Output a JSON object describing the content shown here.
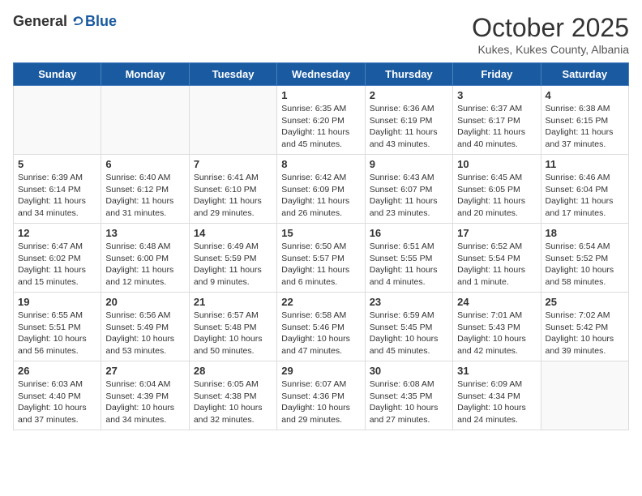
{
  "header": {
    "logo_general": "General",
    "logo_blue": "Blue",
    "month_title": "October 2025",
    "location": "Kukes, Kukes County, Albania"
  },
  "weekdays": [
    "Sunday",
    "Monday",
    "Tuesday",
    "Wednesday",
    "Thursday",
    "Friday",
    "Saturday"
  ],
  "weeks": [
    [
      {
        "day": "",
        "text": ""
      },
      {
        "day": "",
        "text": ""
      },
      {
        "day": "",
        "text": ""
      },
      {
        "day": "1",
        "text": "Sunrise: 6:35 AM\nSunset: 6:20 PM\nDaylight: 11 hours\nand 45 minutes."
      },
      {
        "day": "2",
        "text": "Sunrise: 6:36 AM\nSunset: 6:19 PM\nDaylight: 11 hours\nand 43 minutes."
      },
      {
        "day": "3",
        "text": "Sunrise: 6:37 AM\nSunset: 6:17 PM\nDaylight: 11 hours\nand 40 minutes."
      },
      {
        "day": "4",
        "text": "Sunrise: 6:38 AM\nSunset: 6:15 PM\nDaylight: 11 hours\nand 37 minutes."
      }
    ],
    [
      {
        "day": "5",
        "text": "Sunrise: 6:39 AM\nSunset: 6:14 PM\nDaylight: 11 hours\nand 34 minutes."
      },
      {
        "day": "6",
        "text": "Sunrise: 6:40 AM\nSunset: 6:12 PM\nDaylight: 11 hours\nand 31 minutes."
      },
      {
        "day": "7",
        "text": "Sunrise: 6:41 AM\nSunset: 6:10 PM\nDaylight: 11 hours\nand 29 minutes."
      },
      {
        "day": "8",
        "text": "Sunrise: 6:42 AM\nSunset: 6:09 PM\nDaylight: 11 hours\nand 26 minutes."
      },
      {
        "day": "9",
        "text": "Sunrise: 6:43 AM\nSunset: 6:07 PM\nDaylight: 11 hours\nand 23 minutes."
      },
      {
        "day": "10",
        "text": "Sunrise: 6:45 AM\nSunset: 6:05 PM\nDaylight: 11 hours\nand 20 minutes."
      },
      {
        "day": "11",
        "text": "Sunrise: 6:46 AM\nSunset: 6:04 PM\nDaylight: 11 hours\nand 17 minutes."
      }
    ],
    [
      {
        "day": "12",
        "text": "Sunrise: 6:47 AM\nSunset: 6:02 PM\nDaylight: 11 hours\nand 15 minutes."
      },
      {
        "day": "13",
        "text": "Sunrise: 6:48 AM\nSunset: 6:00 PM\nDaylight: 11 hours\nand 12 minutes."
      },
      {
        "day": "14",
        "text": "Sunrise: 6:49 AM\nSunset: 5:59 PM\nDaylight: 11 hours\nand 9 minutes."
      },
      {
        "day": "15",
        "text": "Sunrise: 6:50 AM\nSunset: 5:57 PM\nDaylight: 11 hours\nand 6 minutes."
      },
      {
        "day": "16",
        "text": "Sunrise: 6:51 AM\nSunset: 5:55 PM\nDaylight: 11 hours\nand 4 minutes."
      },
      {
        "day": "17",
        "text": "Sunrise: 6:52 AM\nSunset: 5:54 PM\nDaylight: 11 hours\nand 1 minute."
      },
      {
        "day": "18",
        "text": "Sunrise: 6:54 AM\nSunset: 5:52 PM\nDaylight: 10 hours\nand 58 minutes."
      }
    ],
    [
      {
        "day": "19",
        "text": "Sunrise: 6:55 AM\nSunset: 5:51 PM\nDaylight: 10 hours\nand 56 minutes."
      },
      {
        "day": "20",
        "text": "Sunrise: 6:56 AM\nSunset: 5:49 PM\nDaylight: 10 hours\nand 53 minutes."
      },
      {
        "day": "21",
        "text": "Sunrise: 6:57 AM\nSunset: 5:48 PM\nDaylight: 10 hours\nand 50 minutes."
      },
      {
        "day": "22",
        "text": "Sunrise: 6:58 AM\nSunset: 5:46 PM\nDaylight: 10 hours\nand 47 minutes."
      },
      {
        "day": "23",
        "text": "Sunrise: 6:59 AM\nSunset: 5:45 PM\nDaylight: 10 hours\nand 45 minutes."
      },
      {
        "day": "24",
        "text": "Sunrise: 7:01 AM\nSunset: 5:43 PM\nDaylight: 10 hours\nand 42 minutes."
      },
      {
        "day": "25",
        "text": "Sunrise: 7:02 AM\nSunset: 5:42 PM\nDaylight: 10 hours\nand 39 minutes."
      }
    ],
    [
      {
        "day": "26",
        "text": "Sunrise: 6:03 AM\nSunset: 4:40 PM\nDaylight: 10 hours\nand 37 minutes."
      },
      {
        "day": "27",
        "text": "Sunrise: 6:04 AM\nSunset: 4:39 PM\nDaylight: 10 hours\nand 34 minutes."
      },
      {
        "day": "28",
        "text": "Sunrise: 6:05 AM\nSunset: 4:38 PM\nDaylight: 10 hours\nand 32 minutes."
      },
      {
        "day": "29",
        "text": "Sunrise: 6:07 AM\nSunset: 4:36 PM\nDaylight: 10 hours\nand 29 minutes."
      },
      {
        "day": "30",
        "text": "Sunrise: 6:08 AM\nSunset: 4:35 PM\nDaylight: 10 hours\nand 27 minutes."
      },
      {
        "day": "31",
        "text": "Sunrise: 6:09 AM\nSunset: 4:34 PM\nDaylight: 10 hours\nand 24 minutes."
      },
      {
        "day": "",
        "text": ""
      }
    ]
  ]
}
